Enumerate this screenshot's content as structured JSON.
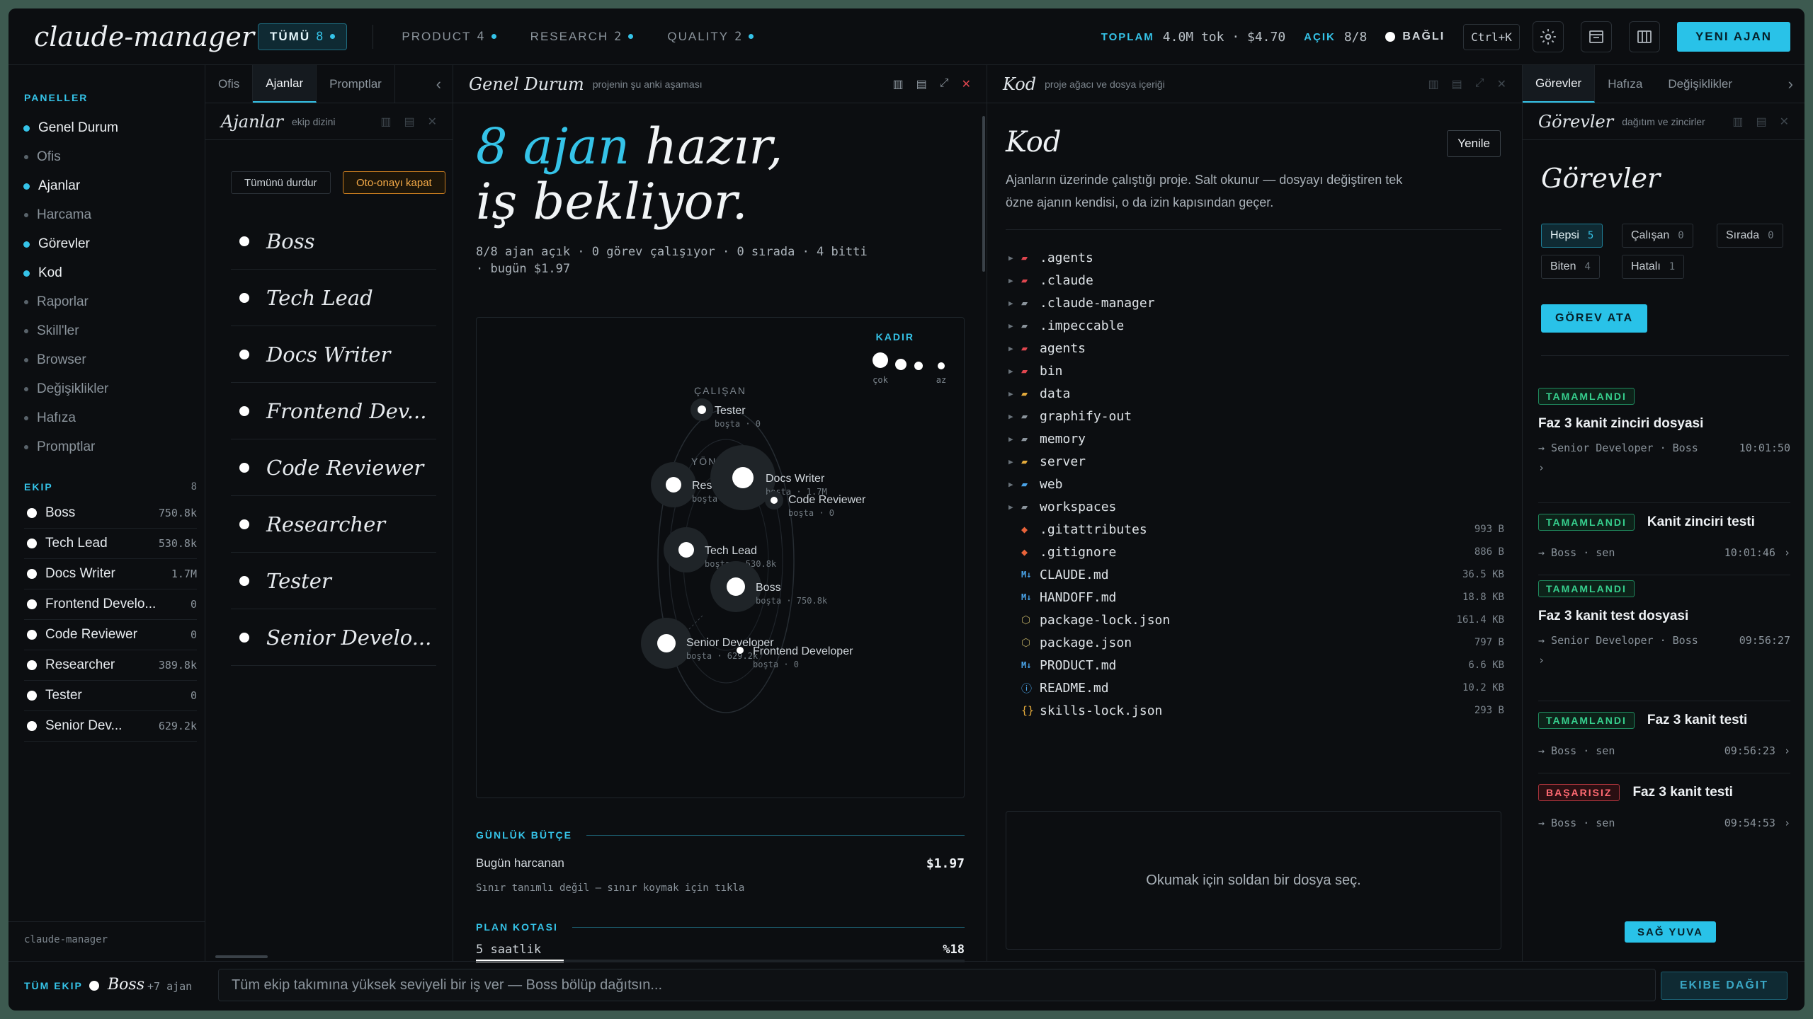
{
  "app": {
    "title": "claude-manager"
  },
  "top": {
    "tabs": [
      {
        "label": "TÜMÜ",
        "count": "8"
      },
      {
        "label": "PRODUCT",
        "count": "4"
      },
      {
        "label": "RESEARCH",
        "count": "2"
      },
      {
        "label": "QUALITY",
        "count": "2"
      }
    ],
    "toplam_label": "TOPLAM",
    "toplam_val": "4.0M tok · $4.70",
    "acik_label": "AÇIK",
    "acik_val": "8/8",
    "conn": "BAĞLI",
    "shortcut": "Ctrl+K",
    "new_agent": "YENI AJAN",
    "icons": [
      "settings-icon",
      "window-icon",
      "columns-icon"
    ]
  },
  "sidebar": {
    "panels_title": "PANELLER",
    "items": [
      {
        "label": "Genel Durum",
        "active": true
      },
      {
        "label": "Ofis",
        "active": false
      },
      {
        "label": "Ajanlar",
        "active": true
      },
      {
        "label": "Harcama",
        "active": false
      },
      {
        "label": "Görevler",
        "active": true
      },
      {
        "label": "Kod",
        "active": true
      },
      {
        "label": "Raporlar",
        "active": false
      },
      {
        "label": "Skill'ler",
        "active": false
      },
      {
        "label": "Browser",
        "active": false
      },
      {
        "label": "Değişiklikler",
        "active": false
      },
      {
        "label": "Hafıza",
        "active": false
      },
      {
        "label": "Promptlar",
        "active": false
      }
    ],
    "team_title": "EKIP",
    "team_count": "8",
    "team": [
      {
        "name": "Boss",
        "val": "750.8k"
      },
      {
        "name": "Tech Lead",
        "val": "530.8k"
      },
      {
        "name": "Docs Writer",
        "val": "1.7M"
      },
      {
        "name": "Frontend Develo...",
        "val": "0"
      },
      {
        "name": "Code Reviewer",
        "val": "0"
      },
      {
        "name": "Researcher",
        "val": "389.8k"
      },
      {
        "name": "Tester",
        "val": "0"
      },
      {
        "name": "Senior Dev...",
        "val": "629.2k"
      }
    ],
    "footer": "claude-manager"
  },
  "agents_panel": {
    "tabs": [
      "Ofis",
      "Ajanlar",
      "Promptlar"
    ],
    "collapse": "‹",
    "title": "Ajanlar",
    "subtitle": "ekip dizini",
    "stop_all": "Tümünü durdur",
    "auto_approve": "Oto-onayı kapat",
    "agents": [
      "Boss",
      "Tech Lead",
      "Docs Writer",
      "Frontend Dev...",
      "Code Reviewer",
      "Researcher",
      "Tester",
      "Senior Develo..."
    ]
  },
  "overview": {
    "title": "Genel Durum",
    "subtitle": "projenin şu anki aşaması",
    "hero_count": "8 ajan",
    "hero_rest": " hazır,",
    "hero_line2": "iş bekliyor.",
    "summary_line1": "8/8 ajan açık · 0 görev çalışıyor · 0 sırada · 4 bitti",
    "summary_line2": "· bugün $1.97",
    "graph": {
      "legend_title": "KADIR",
      "legend_lo": "çok",
      "legend_hi": "az",
      "group_worker": "ÇALIŞAN",
      "group_manager": "YÖNETİCİ",
      "nodes": [
        {
          "name": "Tester",
          "status": "boşta · 0"
        },
        {
          "name": "Researcher",
          "status": "boşta · 389.8k"
        },
        {
          "name": "Docs Writer",
          "status": "boşta · 1.7M"
        },
        {
          "name": "Code Reviewer",
          "status": "boşta · 0"
        },
        {
          "name": "Tech Lead",
          "status": "boşta · 530.8k"
        },
        {
          "name": "Boss",
          "status": "boşta · 750.8k"
        },
        {
          "name": "Senior Developer",
          "status": "boşta · 629.2k"
        },
        {
          "name": "Frontend Developer",
          "status": "boşta · 0"
        }
      ]
    },
    "budget_title": "GÜNLÜK BÜTÇE",
    "spent_label": "Bugün harcanan",
    "spent_val": "$1.97",
    "limit_note": "Sınır tanımlı değil — sınır koymak için tıkla",
    "quota_title": "PLAN KOTASI",
    "quota_label": "5 saatlik",
    "quota_pct": "%18",
    "quota_fraction": 0.18
  },
  "code": {
    "title": "Kod",
    "subtitle": "proje ağacı ve dosya içeriği",
    "heading": "Kod",
    "refresh": "Yenile",
    "desc1": "Ajanların üzerinde çalıştığı proje. Salt okunur — dosyayı değiştiren tek",
    "desc2": "özne ajanın kendisi, o da izin kapısından geçer.",
    "tree": [
      {
        "name": ".agents",
        "type": "folder-red",
        "size": ""
      },
      {
        "name": ".claude",
        "type": "folder-red",
        "size": ""
      },
      {
        "name": ".claude-manager",
        "type": "folder",
        "size": ""
      },
      {
        "name": ".impeccable",
        "type": "folder",
        "size": ""
      },
      {
        "name": "agents",
        "type": "folder-red",
        "size": ""
      },
      {
        "name": "bin",
        "type": "folder-red",
        "size": ""
      },
      {
        "name": "data",
        "type": "folder-yellow",
        "size": ""
      },
      {
        "name": "graphify-out",
        "type": "folder",
        "size": ""
      },
      {
        "name": "memory",
        "type": "folder",
        "size": ""
      },
      {
        "name": "server",
        "type": "folder-yellow",
        "size": ""
      },
      {
        "name": "web",
        "type": "folder-blue",
        "size": ""
      },
      {
        "name": "workspaces",
        "type": "folder",
        "size": ""
      },
      {
        "name": ".gitattributes",
        "type": "git",
        "size": "993 B"
      },
      {
        "name": ".gitignore",
        "type": "git",
        "size": "886 B"
      },
      {
        "name": "CLAUDE.md",
        "type": "md",
        "size": "36.5 KB"
      },
      {
        "name": "HANDOFF.md",
        "type": "md",
        "size": "18.8 KB"
      },
      {
        "name": "package-lock.json",
        "type": "npm",
        "size": "161.4 KB"
      },
      {
        "name": "package.json",
        "type": "npm",
        "size": "797 B"
      },
      {
        "name": "PRODUCT.md",
        "type": "md",
        "size": "6.6 KB"
      },
      {
        "name": "README.md",
        "type": "info",
        "size": "10.2 KB"
      },
      {
        "name": "skills-lock.json",
        "type": "json",
        "size": "293 B"
      }
    ],
    "empty": "Okumak için soldan bir dosya seç."
  },
  "tasks": {
    "tabs": [
      "Görevler",
      "Hafıza",
      "Değişiklikler"
    ],
    "title": "Görevler",
    "subtitle": "dağıtım ve zincirler",
    "heading": "Görevler",
    "filters": [
      {
        "label": "Hepsi",
        "count": "5"
      },
      {
        "label": "Çalışan",
        "count": "0"
      },
      {
        "label": "Sırada",
        "count": "0"
      },
      {
        "label": "Biten",
        "count": "4"
      },
      {
        "label": "Hatalı",
        "count": "1"
      }
    ],
    "assign": "GÖREV ATA",
    "items": [
      {
        "status": "TAMAMLANDI",
        "title": "Faz 3 kanit zinciri dosyasi",
        "meta": "→ Senior Developer · Boss",
        "time": "10:01:50",
        "fail": false
      },
      {
        "status": "TAMAMLANDI",
        "title": "Kanit zinciri testi",
        "meta": "→ Boss · sen",
        "time": "10:01:46",
        "fail": false
      },
      {
        "status": "TAMAMLANDI",
        "title": "Faz 3 kanit test dosyasi",
        "meta": "→ Senior Developer · Boss",
        "time": "09:56:27",
        "fail": false
      },
      {
        "status": "TAMAMLANDI",
        "title": "Faz 3 kanit testi",
        "meta": "→ Boss · sen",
        "time": "09:56:23",
        "fail": false
      },
      {
        "status": "BAŞARISIZ",
        "title": "Faz 3 kanit testi",
        "meta": "→ Boss · sen",
        "time": "09:54:53",
        "fail": true
      }
    ],
    "dock": "SAĞ YUVA"
  },
  "bottom": {
    "all_team": "TÜM EKIP",
    "boss": "Boss",
    "extra": "+7 ajan",
    "placeholder": "Tüm ekip takımına yüksek seviyeli bir iş ver — Boss bölüp dağıtsın...",
    "send": "EKIBE DAĞIT"
  },
  "colors": {
    "accent": "#35c3e8",
    "success": "#36d08e",
    "danger": "#ff6a72",
    "warning": "#f3a947"
  }
}
